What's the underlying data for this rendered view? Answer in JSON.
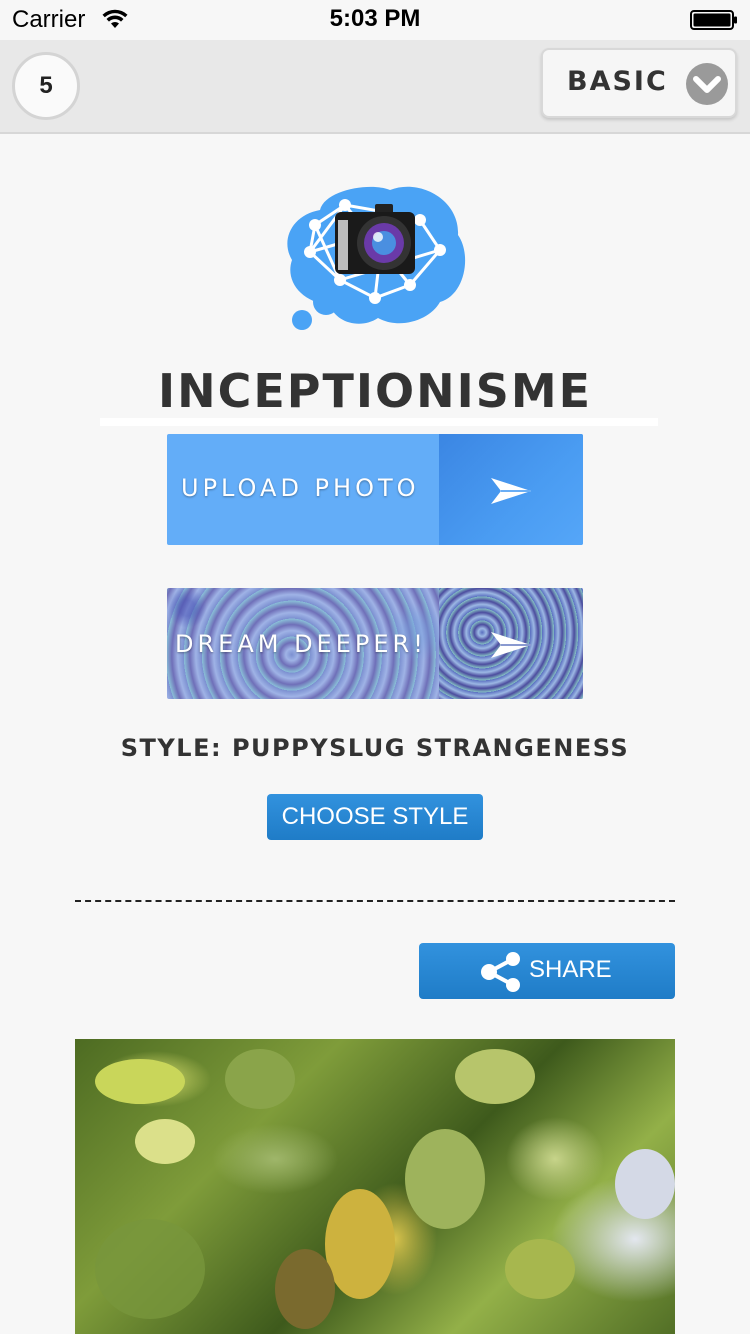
{
  "status_bar": {
    "carrier": "Carrier",
    "time": "5:03 PM"
  },
  "top_bar": {
    "count": "5",
    "mode": "BASIC"
  },
  "app": {
    "title": "INCEPTIONISME"
  },
  "buttons": {
    "upload_photo": "UPLOAD PHOTO",
    "dream_deeper": "DREAM DEEPER!",
    "choose_style": "CHOOSE STYLE",
    "share": "SHARE"
  },
  "style": {
    "label": "STYLE: PUPPYSLUG STRANGENESS"
  },
  "icons": {
    "wifi": "wifi-icon",
    "battery": "battery-icon",
    "dropdown": "chevron-down-icon",
    "send": "paper-plane-icon",
    "share": "share-icon",
    "logo": "brain-camera-logo"
  },
  "colors": {
    "accent_blue": "#2a87d4",
    "upload_blue": "#63adf8",
    "logo_blue": "#4a9ff5"
  }
}
